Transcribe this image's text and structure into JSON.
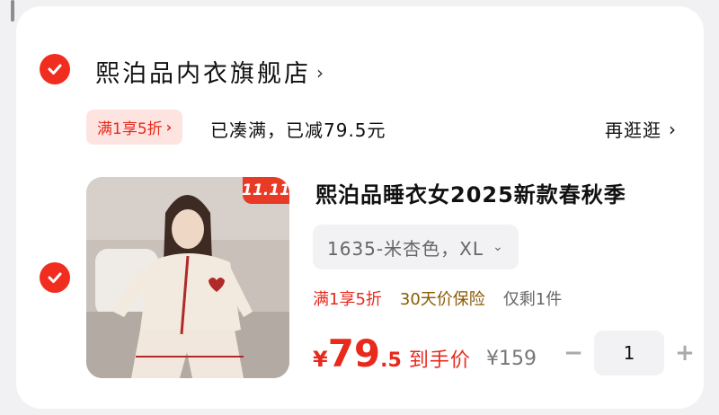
{
  "store": {
    "name": "熙泊品内衣旗舰店",
    "chevron": "›"
  },
  "promo": {
    "tag_label": "满1享5折",
    "tag_arrow": "›",
    "text": "已凑满，已减79.5元",
    "browse_label": "再逛逛",
    "browse_arrow": "›"
  },
  "item": {
    "badge": "11.11",
    "title": "熙泊品睡衣女2025新款春秋季",
    "sku": "1635-米杏色，XL",
    "sku_arrow": "⌄",
    "tags": [
      "满1享5折",
      "30天价保险",
      "仅剩1件"
    ],
    "price_currency": "¥",
    "price_int": "79",
    "price_dec": ".5",
    "price_label": "到手价",
    "original_price": "¥159",
    "quantity": "1",
    "minus": "−",
    "plus": "+"
  },
  "colors": {
    "accent": "#f02d1f",
    "promo_bg": "#fde4e1"
  }
}
